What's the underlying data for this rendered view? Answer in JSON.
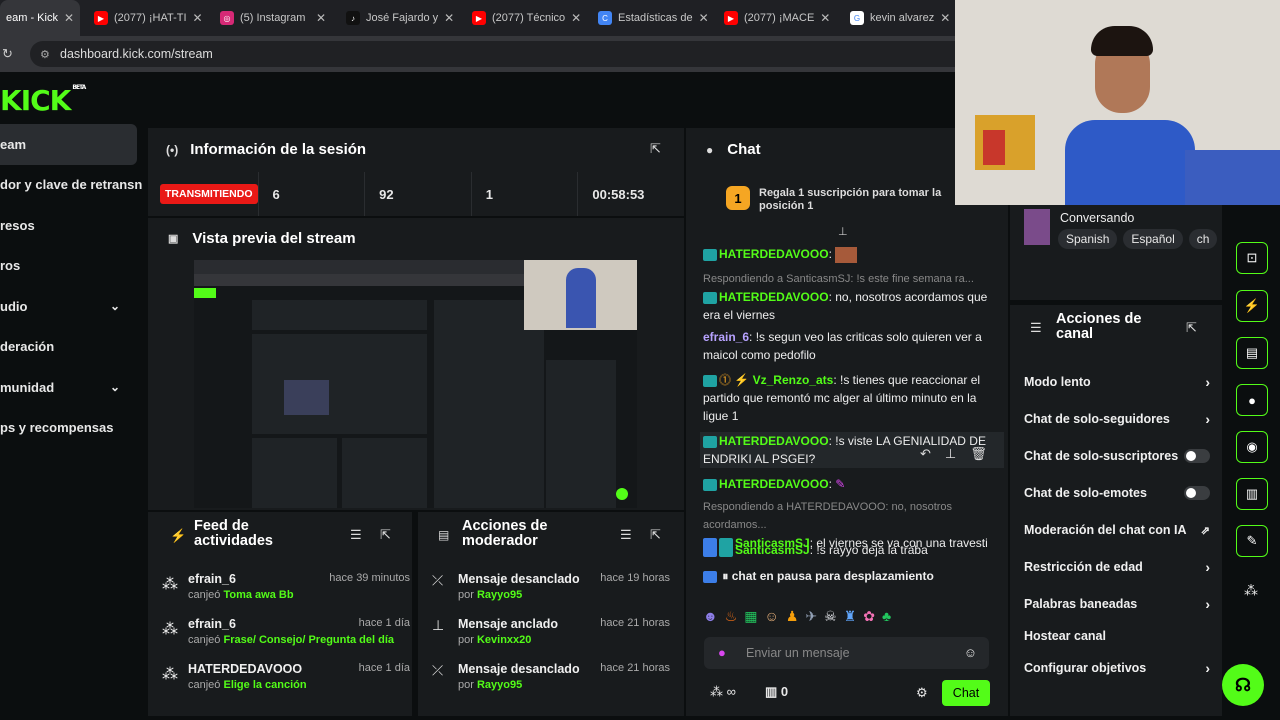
{
  "tabs": [
    {
      "label": "eam - Kick",
      "icon": "kick-icon",
      "color": "#53fc18"
    },
    {
      "label": "(2077) ¡HAT-TI",
      "icon": "youtube-icon",
      "color": "#ff0000"
    },
    {
      "label": "(5) Instagram",
      "icon": "instagram-icon",
      "color": "#d62976"
    },
    {
      "label": "José Fajardo y",
      "icon": "tiktok-icon",
      "color": "#000000"
    },
    {
      "label": "(2077) Técnico",
      "icon": "youtube-icon",
      "color": "#ff0000"
    },
    {
      "label": "Estadísticas de",
      "icon": "stats-icon",
      "color": "#4285f4"
    },
    {
      "label": "(2077) ¡MACE",
      "icon": "youtube-icon",
      "color": "#ff0000"
    },
    {
      "label": "kevin alvarez",
      "icon": "google-icon",
      "color": "#4285f4"
    }
  ],
  "url": "dashboard.kick.com/stream",
  "logo": "KICK",
  "logo_beta": "BETA",
  "sidebar": [
    {
      "label": "eam",
      "active": true
    },
    {
      "label": "dor y clave de retransn"
    },
    {
      "label": "resos"
    },
    {
      "label": "ros"
    },
    {
      "label": "udio",
      "chevron": "⌄"
    },
    {
      "label": "deración"
    },
    {
      "label": "munidad",
      "chevron": "⌄"
    },
    {
      "label": "ps y recompensas"
    }
  ],
  "session": {
    "title": "Información de la sesión",
    "status": "TRANSMITIENDO",
    "viewers": "6",
    "followers": "92",
    "subs": "1",
    "duration": "00:58:53"
  },
  "preview": {
    "title": "Vista previa del stream"
  },
  "feed": {
    "title": "Feed de actividades",
    "rows": [
      {
        "user": "efrain_6",
        "text": "canjeó",
        "reward": "Toma awa Bb",
        "time": "hace 39 minutos"
      },
      {
        "user": "efrain_6",
        "text": "canjeó",
        "reward": "Frase/ Consejo/ Pregunta del día",
        "time": "hace 1 día"
      },
      {
        "user": "HATERDEDAVOOO",
        "text": "canjeó",
        "reward": "Elige la canción",
        "time": "hace 1 día"
      }
    ]
  },
  "mod": {
    "title": "Acciones de moderador",
    "rows": [
      {
        "action": "Mensaje desanclado",
        "by": "por",
        "user": "Rayyo95",
        "time": "hace 19 horas",
        "icon": "unpin-icon"
      },
      {
        "action": "Mensaje anclado",
        "by": "por",
        "user": "Kevinxx20",
        "time": "hace 21 horas",
        "icon": "pin-icon"
      },
      {
        "action": "Mensaje desanclado",
        "by": "por",
        "user": "Rayyo95",
        "time": "hace 21 horas",
        "icon": "unpin-icon"
      }
    ]
  },
  "chat": {
    "title": "Chat",
    "gift_number": "1",
    "gift_text": "Regala 1 suscripción para tomar la posición 1",
    "messages": [
      {
        "user": "HATERDEDAVOOO",
        "text": ":"
      },
      {
        "reply": "Respondiendo a SanticasmSJ: !s este fine semana ra...",
        "user": "HATERDEDAVOOO",
        "text": ": no, nosotros acordamos que era el viernes"
      },
      {
        "user": "efrain_6",
        "text": ": !s segun veo las criticas solo quieren ver a maicol como pedofilo"
      },
      {
        "user": "Vz_Renzo_ats",
        "text": ": !s tienes que reaccionar el partido que remontó mc alger al último minuto en la ligue 1"
      },
      {
        "user": "HATERDEDAVOOO",
        "text": ": !s viste LA GENIALIDAD DE ENDRIKI AL PSGEI?"
      },
      {
        "user": "HATERDEDAVOOO",
        "text": ":"
      },
      {
        "reply": "Respondiendo a HATERDEDAVOOO: no, nosotros acordamos...",
        "user": "SanticasmSJ",
        "text": ": el viernes se va con una travesti"
      },
      {
        "user": "SanticasmSJ",
        "text": ": !s rayyo deja la traba"
      }
    ],
    "paused": "chat en pausa para desplazamiento",
    "input_placeholder": "Enviar un mensaje",
    "count": "0",
    "send": "Chat"
  },
  "stream_info": {
    "category": "Conversando",
    "tags": [
      "Spanish",
      "Español",
      "ch"
    ]
  },
  "channel_actions": {
    "title": "Acciones de canal",
    "items": [
      {
        "label": "Modo lento",
        "type": "arrow"
      },
      {
        "label": "Chat de solo-seguidores",
        "type": "arrow"
      },
      {
        "label": "Chat de solo-suscriptores",
        "type": "toggle"
      },
      {
        "label": "Chat de solo-emotes",
        "type": "toggle"
      },
      {
        "label": "Moderación del chat con IA",
        "type": "link"
      },
      {
        "label": "Restricción de edad",
        "type": "arrow"
      },
      {
        "label": "Palabras baneadas",
        "type": "arrow"
      },
      {
        "label": "Hostear canal",
        "type": "none"
      },
      {
        "label": "Configurar objetivos",
        "type": "arrow"
      }
    ]
  },
  "colors": {
    "accent": "#53fc18",
    "live": "#e91916",
    "bg": "#0b0e0f",
    "panel": "#181b1d"
  }
}
